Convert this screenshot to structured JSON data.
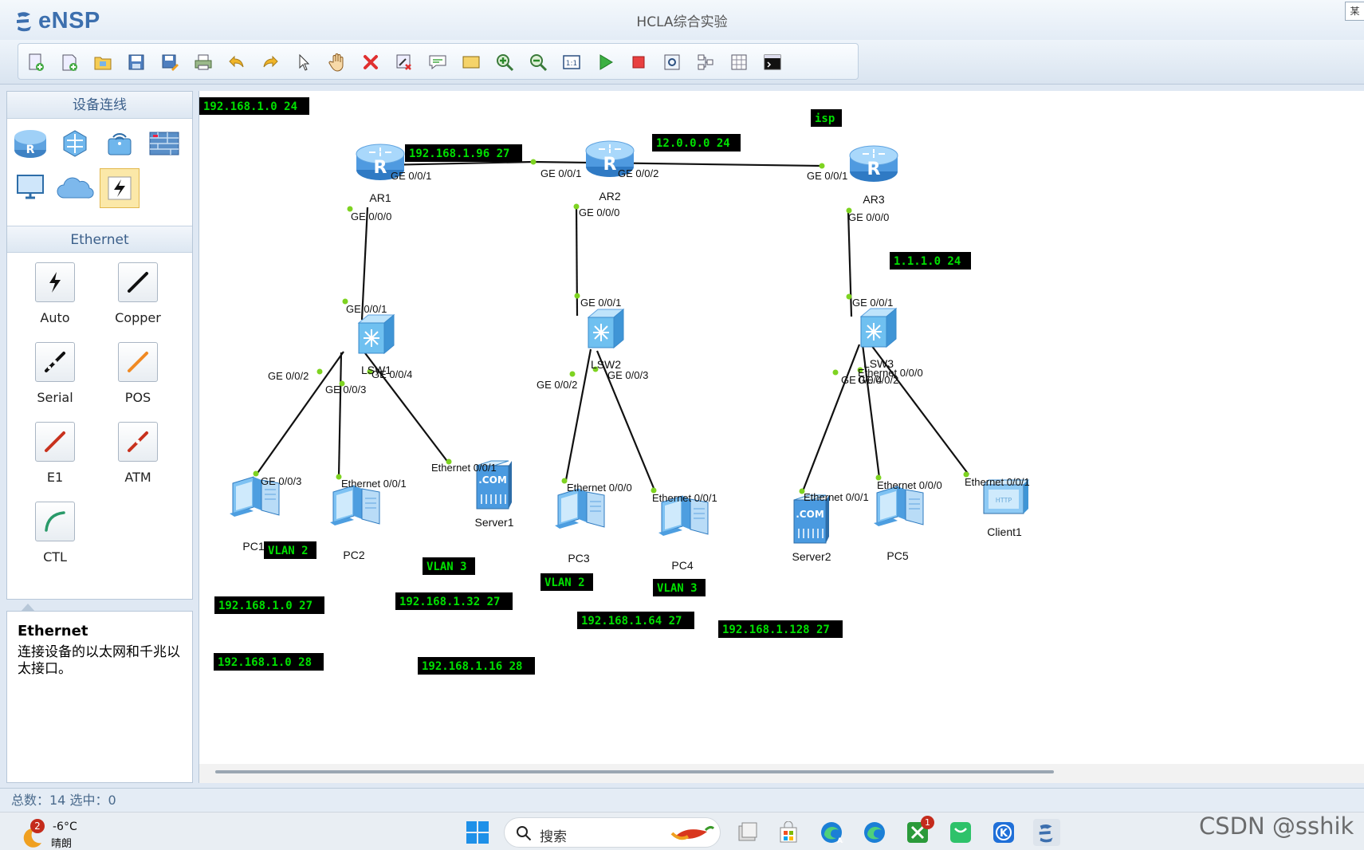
{
  "app": {
    "logo": "eNSP",
    "title": "HCLA综合实验",
    "edge_glyph": "某"
  },
  "toolbar": {
    "buttons": [
      "new-topology",
      "new-exam",
      "open",
      "save",
      "save-as",
      "print",
      "undo",
      "redo",
      "select",
      "pan",
      "delete",
      "delete-link",
      "add-note",
      "add-rectangle",
      "zoom-in",
      "zoom-out",
      "fit",
      "start-device",
      "stop-device",
      "capture",
      "topology-view",
      "grid",
      "interface-tag"
    ]
  },
  "left_panel": {
    "devices_header": "设备连线",
    "devices": [
      "router-icon",
      "switch-icon",
      "wireless-icon",
      "firewall-icon",
      "pc-icon",
      "cloud-icon",
      "cable-icon"
    ],
    "cable_header": "Ethernet",
    "cables": [
      {
        "label": "Auto"
      },
      {
        "label": "Copper"
      },
      {
        "label": "Serial"
      },
      {
        "label": "POS"
      },
      {
        "label": "E1"
      },
      {
        "label": "ATM"
      },
      {
        "label": "CTL"
      }
    ],
    "info_title": "Ethernet",
    "info_desc": "连接设备的以太网和千兆以太接口。"
  },
  "canvas": {
    "devices": [
      {
        "name": "AR1",
        "type": "router"
      },
      {
        "name": "AR2",
        "type": "router"
      },
      {
        "name": "AR3",
        "type": "router"
      },
      {
        "name": "LSW1",
        "type": "switch"
      },
      {
        "name": "LSW2",
        "type": "switch"
      },
      {
        "name": "LSW3",
        "type": "switch"
      },
      {
        "name": "PC1",
        "type": "pc"
      },
      {
        "name": "PC2",
        "type": "pc"
      },
      {
        "name": "PC3",
        "type": "pc"
      },
      {
        "name": "PC4",
        "type": "pc"
      },
      {
        "name": "PC5",
        "type": "pc"
      },
      {
        "name": "Server1",
        "type": "server"
      },
      {
        "name": "Server2",
        "type": "server"
      },
      {
        "name": "Client1",
        "type": "client"
      }
    ],
    "server_text": ".COM",
    "client_text": "HTTP",
    "port_labels": [
      "GE 0/0/1",
      "GE 0/0/1",
      "GE 0/0/2",
      "GE 0/0/1",
      "GE 0/0/0",
      "GE 0/0/0",
      "GE 0/0/0",
      "GE 0/0/1",
      "GE 0/0/1",
      "GE 0/0/1",
      "GE 0/0/2",
      "GE 0/0/3",
      "GE 0/0/4",
      "GE 0/0/2",
      "GE 0/0/3",
      "GE 0/0/4",
      "GE 0/0/2",
      "GE 0/0/3",
      "Ethernet 0/0/1",
      "Ethernet 0/0/1",
      "Ethernet 0/0/0",
      "Ethernet 0/0/1",
      "Ethernet 0/0/1",
      "Ethernet 0/0/0",
      "Ethernet 0/0/1",
      "Ethernet 0/0/0"
    ],
    "notes": [
      "192.168.1.0 24",
      "192.168.1.96 27",
      "12.0.0.0 24",
      "isp",
      "1.1.1.0 24",
      "VLAN 2",
      "VLAN 3",
      "VLAN 2",
      "VLAN 3",
      "192.168.1.0 27",
      "192.168.1.32 27",
      "192.168.1.64 27",
      "192.168.1.128 27",
      "192.168.1.0 28",
      "192.168.1.16 28"
    ]
  },
  "status": {
    "text": "总数：14 选中：0"
  },
  "taskbar": {
    "weather_temp": "-6°C",
    "weather_desc": "晴朗",
    "weather_badge": "2",
    "search_placeholder": "搜索",
    "apps": [
      "pepper-icon",
      "file-explorer-icon",
      "store-icon",
      "edge-ai-icon",
      "edge-icon",
      "xbox-icon",
      "wechat-icon",
      "k-app-icon",
      "ensp-icon"
    ],
    "app_badge": "1",
    "watermark": "CSDN @sshik"
  },
  "colors": {
    "note_bg": "#000000",
    "note_text": "#00e000",
    "port_dot": "#7ed321",
    "link": "#111111"
  }
}
